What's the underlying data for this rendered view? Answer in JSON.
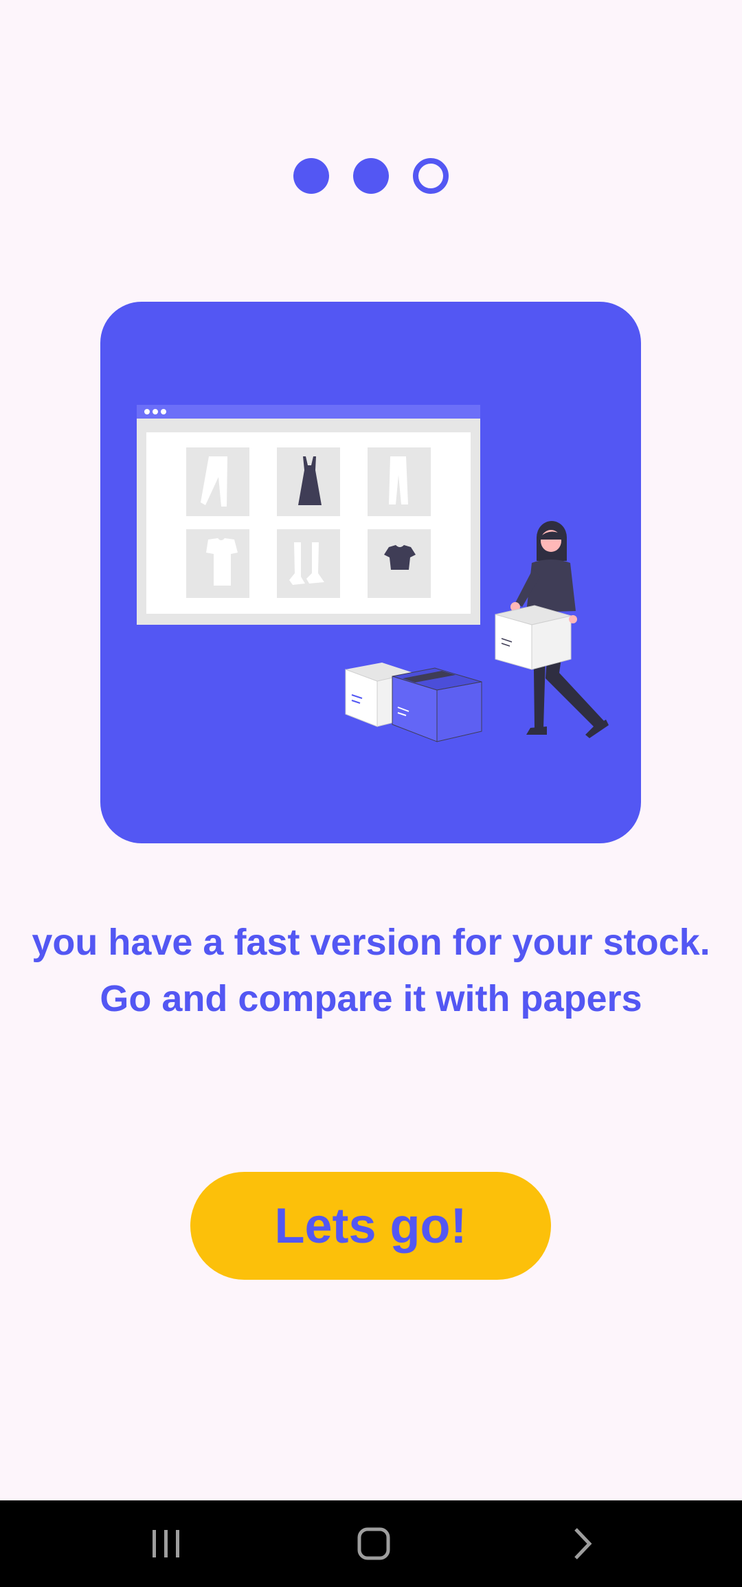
{
  "pager": {
    "total": 3,
    "current": 3,
    "filled": [
      true,
      true,
      false
    ]
  },
  "message": {
    "line1": "you have a fast version for your stock.",
    "line2": "Go and compare it with papers"
  },
  "cta": {
    "label": "Lets go!"
  },
  "navbar": {
    "recent": "recent-apps-icon",
    "home": "home-icon",
    "back": "back-icon"
  },
  "colors": {
    "accent": "#5357f3",
    "button": "#fcc00a",
    "background": "#fdf5fb"
  }
}
